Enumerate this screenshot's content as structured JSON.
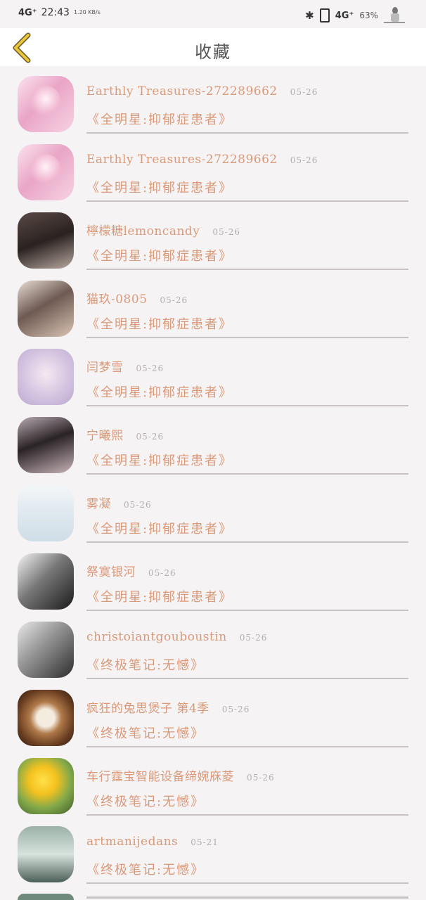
{
  "status_bar": {
    "network": "4G⁺",
    "time": "22:43",
    "speed": "1.20 KB/s",
    "network_right": "4G⁺",
    "battery": "63%"
  },
  "header": {
    "title": "收藏"
  },
  "favorites": [
    {
      "name": "Earthly Treasures-272289662",
      "date": "05-26",
      "subtitle": "《全明星:抑郁症患者》"
    },
    {
      "name": "Earthly Treasures-272289662",
      "date": "05-26",
      "subtitle": "《全明星:抑郁症患者》"
    },
    {
      "name": "檸檬糖lemoncandy",
      "date": "05-26",
      "subtitle": "《全明星:抑郁症患者》"
    },
    {
      "name": "猫玖-0805",
      "date": "05-26",
      "subtitle": "《全明星:抑郁症患者》"
    },
    {
      "name": "闫梦雪",
      "date": "05-26",
      "subtitle": "《全明星:抑郁症患者》"
    },
    {
      "name": "宁曦熙",
      "date": "05-26",
      "subtitle": "《全明星:抑郁症患者》"
    },
    {
      "name": "雾凝",
      "date": "05-26",
      "subtitle": "《全明星:抑郁症患者》"
    },
    {
      "name": "祭寞银河",
      "date": "05-26",
      "subtitle": "《全明星:抑郁症患者》"
    },
    {
      "name": "christoiantgouboustin",
      "date": "05-26",
      "subtitle": "《终极笔记:无憾》"
    },
    {
      "name": "疯狂的兔思煲子 第4季",
      "date": "05-26",
      "subtitle": "《终极笔记:无憾》"
    },
    {
      "name": "车行霆宝智能设备缔婉庥菱",
      "date": "05-26",
      "subtitle": "《终极笔记:无憾》"
    },
    {
      "name": "artmanijedans",
      "date": "05-21",
      "subtitle": "《终极笔记:无憾》"
    }
  ],
  "colors": {
    "accent": "#d89a7a",
    "back_arrow": "#e8c53a",
    "divider": "#c9c4c4"
  },
  "icons": {
    "back": "chevron-left-icon"
  }
}
